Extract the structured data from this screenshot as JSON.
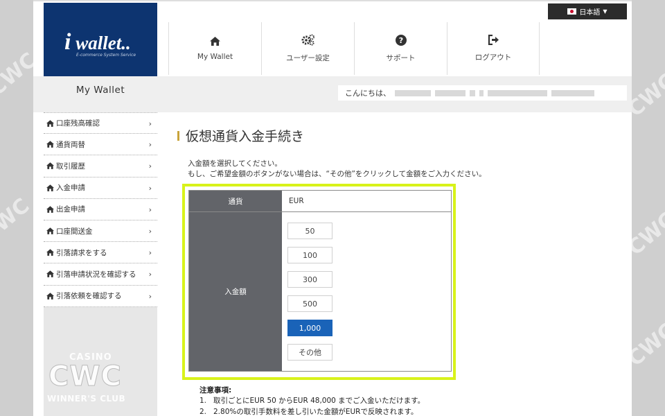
{
  "header": {
    "logo_text": "wallet..",
    "logo_letter": "i",
    "logo_subtitle": "E-commerce System Service",
    "language": "日本語",
    "nav": [
      {
        "label": "My Wallet",
        "icon": "home-icon"
      },
      {
        "label": "ユーザー設定",
        "icon": "gears-icon"
      },
      {
        "label": "サポート",
        "icon": "question-icon"
      },
      {
        "label": "ログアウト",
        "icon": "logout-icon"
      }
    ]
  },
  "sidebar": {
    "title": "My Wallet",
    "items": [
      {
        "label": "口座残高確認"
      },
      {
        "label": "通貨両替"
      },
      {
        "label": "取引履歴"
      },
      {
        "label": "入金申請"
      },
      {
        "label": "出金申請"
      },
      {
        "label": "口座間送金"
      },
      {
        "label": "引落請求をする"
      },
      {
        "label": "引落申請状況を確認する"
      },
      {
        "label": "引落依頼を確認する"
      }
    ]
  },
  "greeting": {
    "prefix": "こんにちは、"
  },
  "main": {
    "title": "仮想通貨入金手続き",
    "intro_line1": "入金額を選択してください。",
    "intro_line2": "もし、ご希望金額のボタンがない場合は、“その他”をクリックして金額をご入力ください。",
    "currency_label": "通貨",
    "currency_value": "EUR",
    "amount_label": "入金額",
    "amounts": [
      "50",
      "100",
      "300",
      "500",
      "1,000",
      "その他"
    ],
    "selected_amount": "1,000",
    "notes_title": "注意事項:",
    "notes": [
      {
        "num": "1.",
        "text": "取引ごとにEUR 50 からEUR 48,000 までご入金いただけます。"
      },
      {
        "num": "2.",
        "text": "2.80%の取引手数料を差し引いた金額がEURで反映されます。"
      }
    ]
  },
  "watermark": {
    "top": "CASINO",
    "main": "CWC",
    "bottom": "WINNER'S CLUB"
  },
  "colors": {
    "brand_navy": "#0d3470",
    "highlight_yellow": "#d8f21a",
    "selected_blue": "#1a63b8",
    "table_header_gray": "#626469",
    "title_accent": "#c8a33a"
  }
}
